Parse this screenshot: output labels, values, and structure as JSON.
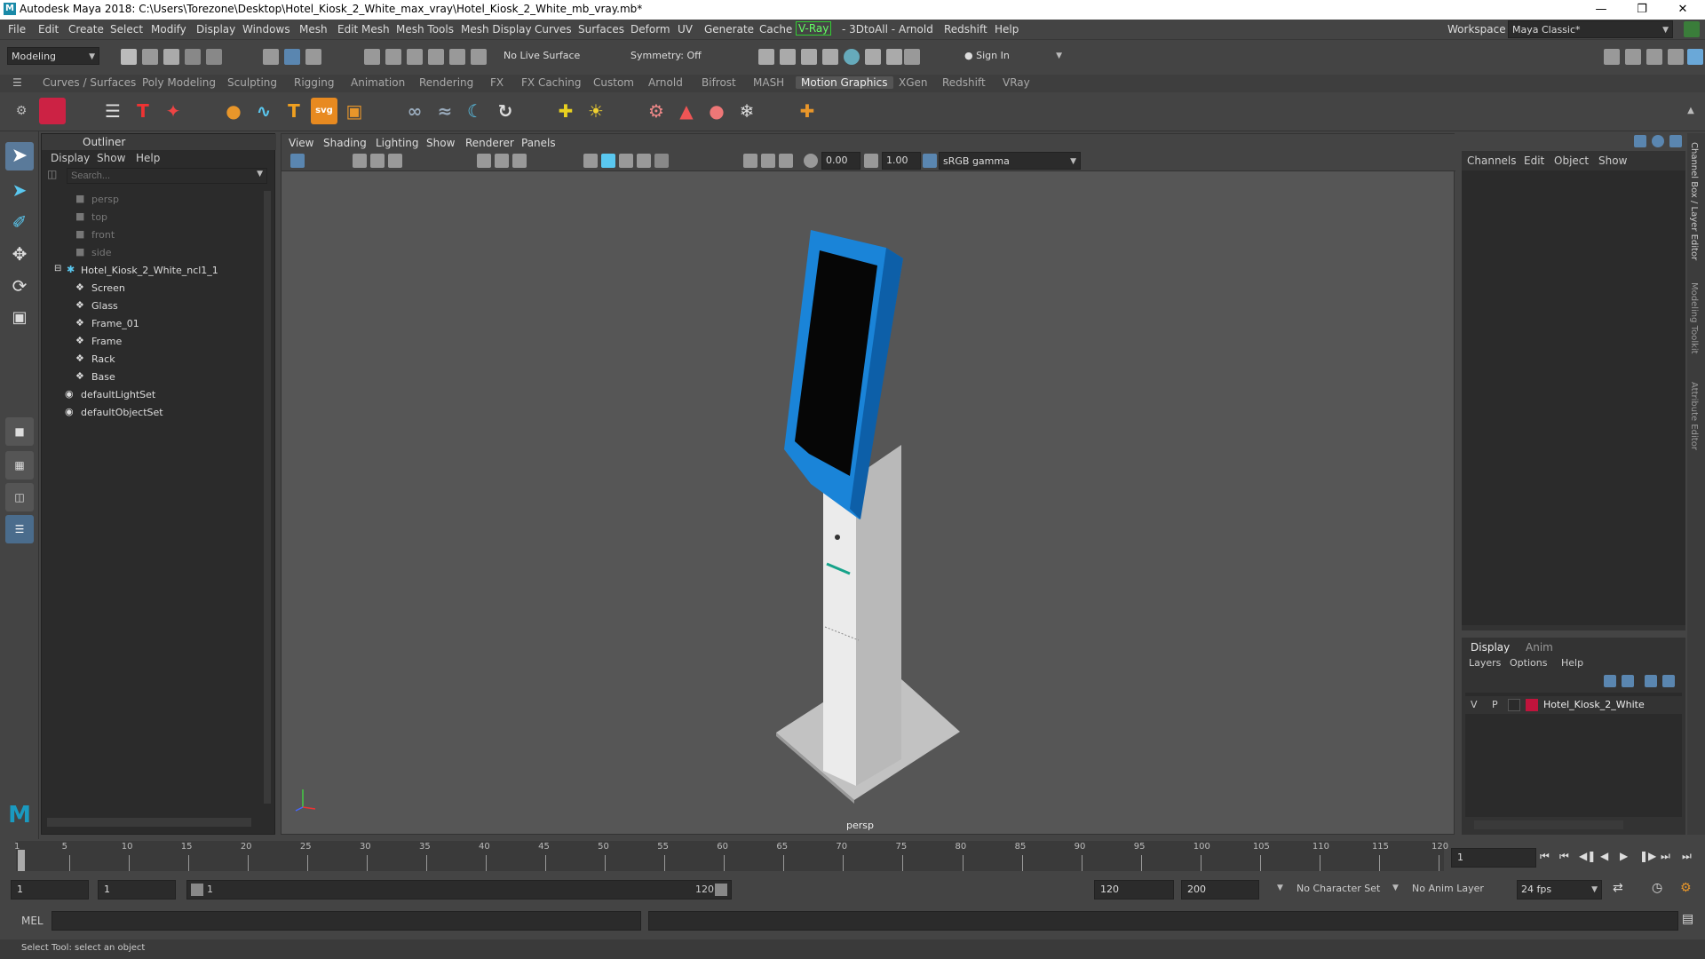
{
  "window": {
    "title": "Autodesk Maya 2018: C:\\Users\\Torezone\\Desktop\\Hotel_Kiosk_2_White_max_vray\\Hotel_Kiosk_2_White_mb_vray.mb*",
    "logo_letter": "M"
  },
  "menubar": {
    "items": [
      "File",
      "Edit",
      "Create",
      "Select",
      "Modify",
      "Display",
      "Windows",
      "Mesh",
      "Edit Mesh",
      "Mesh Tools",
      "Mesh Display",
      "Curves",
      "Surfaces",
      "Deform",
      "UV",
      "Generate",
      "Cache",
      "V-Ray",
      "- 3DtoAll -",
      "Arnold",
      "Redshift",
      "Help"
    ],
    "workspace_label": "Workspace :",
    "workspace_value": "Maya Classic*"
  },
  "statusline": {
    "mode": "Modeling",
    "live_surface": "No Live Surface",
    "symmetry": "Symmetry: Off",
    "sign_in": "Sign In"
  },
  "shelf_tabs": [
    "Curves / Surfaces",
    "Poly Modeling",
    "Sculpting",
    "Rigging",
    "Animation",
    "Rendering",
    "FX",
    "FX Caching",
    "Custom",
    "Arnold",
    "Bifrost",
    "MASH",
    "Motion Graphics",
    "XGen",
    "Redshift",
    "VRay"
  ],
  "active_shelf_tab": "Motion Graphics",
  "outliner": {
    "title": "Outliner",
    "menu": [
      "Display",
      "Show",
      "Help"
    ],
    "search_placeholder": "Search...",
    "cameras": [
      "persp",
      "top",
      "front",
      "side"
    ],
    "group": "Hotel_Kiosk_2_White_ncl1_1",
    "children": [
      "Screen",
      "Glass",
      "Frame_01",
      "Frame",
      "Rack",
      "Base"
    ],
    "sets": [
      "defaultLightSet",
      "defaultObjectSet"
    ]
  },
  "viewport": {
    "menu": [
      "View",
      "Shading",
      "Lighting",
      "Show",
      "Renderer",
      "Panels"
    ],
    "exposure": "0.00",
    "gamma": "1.00",
    "color_space": "sRGB gamma",
    "camera_label": "persp"
  },
  "channelbox": {
    "menu": [
      "Channels",
      "Edit",
      "Object",
      "Show"
    ]
  },
  "layers": {
    "tabs": [
      "Display",
      "Anim"
    ],
    "menu": [
      "Layers",
      "Options",
      "Help"
    ],
    "layer_v": "V",
    "layer_p": "P",
    "layer_name": "Hotel_Kiosk_2_White",
    "layer_color": "#c0143c"
  },
  "right_strip": [
    "Channel Box / Layer Editor",
    "Modeling Toolkit",
    "Attribute Editor"
  ],
  "timeline": {
    "ticks": [
      "1",
      "5",
      "10",
      "15",
      "20",
      "25",
      "30",
      "35",
      "40",
      "45",
      "50",
      "55",
      "60",
      "65",
      "70",
      "75",
      "80",
      "85",
      "90",
      "95",
      "100",
      "105",
      "110",
      "115",
      "120"
    ],
    "current_frame": "1"
  },
  "range": {
    "start": "1",
    "playback_start": "1",
    "slider_start": "1",
    "slider_end": "120",
    "playback_end": "120",
    "end": "200",
    "character_set": "No Character Set",
    "anim_layer": "No Anim Layer",
    "fps": "24 fps"
  },
  "cmdline": {
    "label": "MEL"
  },
  "helpline": {
    "text": "Select Tool: select an object"
  }
}
